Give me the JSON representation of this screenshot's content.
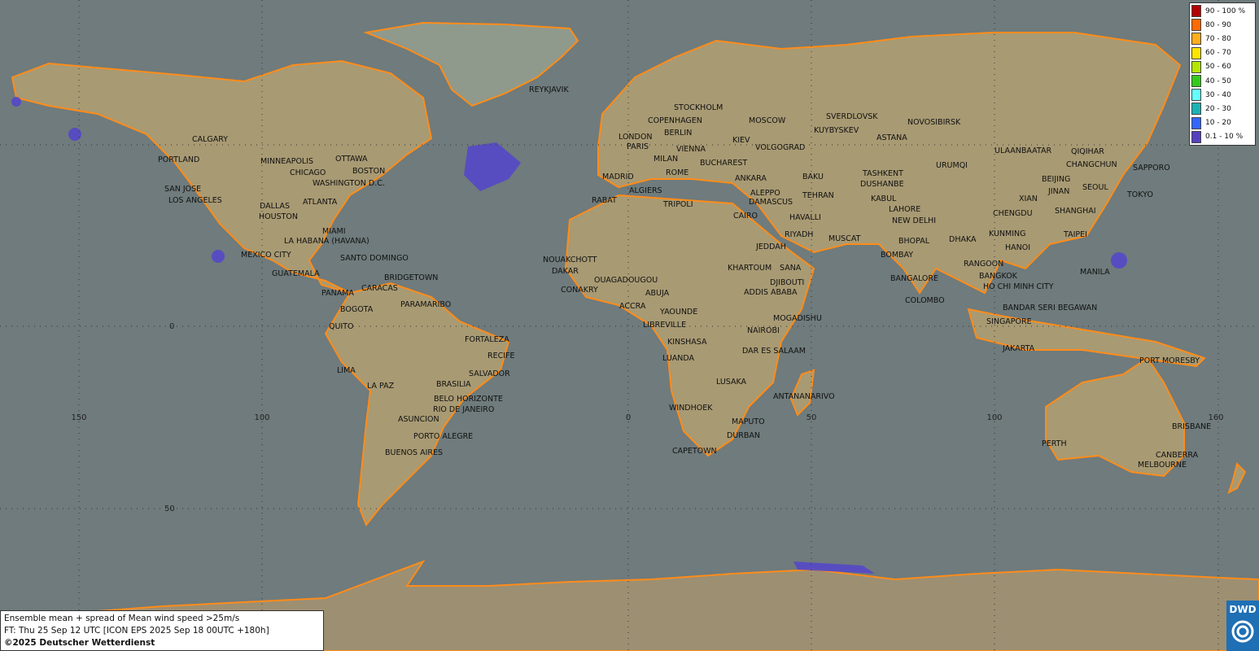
{
  "colors": {
    "ocean": "#6f7b7c",
    "land": "#a89a73",
    "coast_high_prob": "#ff8c1a",
    "low_prob": "#5548c8"
  },
  "legend": [
    {
      "label": "90 - 100 %",
      "color": "#b30000"
    },
    {
      "label": "80 - 90",
      "color": "#ff6a00"
    },
    {
      "label": "70 - 80",
      "color": "#ffae1a"
    },
    {
      "label": "60 - 70",
      "color": "#ffe600"
    },
    {
      "label": "50 - 60",
      "color": "#b3e600"
    },
    {
      "label": "40 - 50",
      "color": "#33cc1a"
    },
    {
      "label": "30 - 40",
      "color": "#66ffff"
    },
    {
      "label": "20 - 30",
      "color": "#1ab3b3"
    },
    {
      "label": "10 - 20",
      "color": "#3366ff"
    },
    {
      "label": "0.1 - 10 %",
      "color": "#5540c0"
    }
  ],
  "grid_labels": {
    "lon": [
      "150",
      "100",
      "0",
      "50",
      "100",
      "160"
    ],
    "lat": [
      "0",
      "50"
    ]
  },
  "cities": [
    "REYKJAVIK",
    "STOCKHOLM",
    "COPENHAGEN",
    "MOSCOW",
    "SVERDLOVSK",
    "NOVOSIBIRSK",
    "KUYBYSKEV",
    "BERLIN",
    "LONDON",
    "PARIS",
    "VIENNA",
    "KIEV",
    "VOLGOGRAD",
    "ASTANA",
    "ULAANBAATAR",
    "QIQIHAR",
    "CHANGCHUN",
    "SAPPORO",
    "URUMQI",
    "MILAN",
    "BUCHAREST",
    "BAKU",
    "TASHKENT",
    "DUSHANBE",
    "BEIJING",
    "SEOUL",
    "JINAN",
    "TOKYO",
    "MADRID",
    "ROME",
    "ANKARA",
    "KABUL",
    "XIAN",
    "RABAT",
    "ALGIERS",
    "ALEPPO",
    "DAMASCUS",
    "TEHRAN",
    "LAHORE",
    "CHENGDU",
    "SHANGHAI",
    "TRIPOLI",
    "CAIRO",
    "HAVALLI",
    "NEW DELHI",
    "KUNMING",
    "TAIPEI",
    "RIYADH",
    "MUSCAT",
    "BHOPAL",
    "DHAKA",
    "HANOI",
    "JEDDAH",
    "BOMBAY",
    "RANGOON",
    "MANILA",
    "NOUAKCHOTT",
    "DAKAR",
    "CONAKRY",
    "OUAGADOUGOU",
    "ABUJA",
    "ACCRA",
    "KHARTOUM",
    "SANA",
    "DJIBOUTI",
    "ADDIS ABABA",
    "BANGALORE",
    "BANGKOK",
    "HO CHI MINH CITY",
    "COLOMBO",
    "YAOUNDE",
    "LIBREVILLE",
    "MOGADISHU",
    "BANDAR SERI BEGAWAN",
    "NAIROBI",
    "SINGAPORE",
    "KINSHASA",
    "LUANDA",
    "DAR ES SALAAM",
    "JAKARTA",
    "PORT MORESBY",
    "LUSAKA",
    "ANTANANARIVO",
    "WINDHOEK",
    "MAPUTO",
    "DURBAN",
    "CAPETOWN",
    "PERTH",
    "BRISBANE",
    "CANBERRA",
    "MELBOURNE",
    "CALGARY",
    "PORTLAND",
    "MINNEAPOLIS",
    "OTTAWA",
    "CHICAGO",
    "BOSTON",
    "WASHINGTON D.C.",
    "SAN JOSE",
    "LOS ANGELES",
    "ATLANTA",
    "DALLAS",
    "HOUSTON",
    "MIAMI",
    "LA HABANA (HAVANA)",
    "SANTO DOMINGO",
    "MEXICO CITY",
    "GUATEMALA",
    "BRIDGETOWN",
    "PANAMA",
    "CARACAS",
    "BOGOTA",
    "PARAMARIBO",
    "QUITO",
    "FORTALEZA",
    "RECIFE",
    "LIMA",
    "SALVADOR",
    "BRASILIA",
    "LA PAZ",
    "BELO HORIZONTE",
    "RIO DE JANEIRO",
    "ASUNCION",
    "PORTO ALEGRE",
    "BUENOS AIRES"
  ],
  "info": {
    "line1": "Ensemble mean + spread of Mean wind speed >25m/s",
    "line2": "FT: Thu 25 Sep 12 UTC [ICON EPS 2025 Sep 18 00UTC +180h]",
    "line3": "©2025 Deutscher Wetterdienst"
  },
  "logo": {
    "text": "DWD"
  }
}
